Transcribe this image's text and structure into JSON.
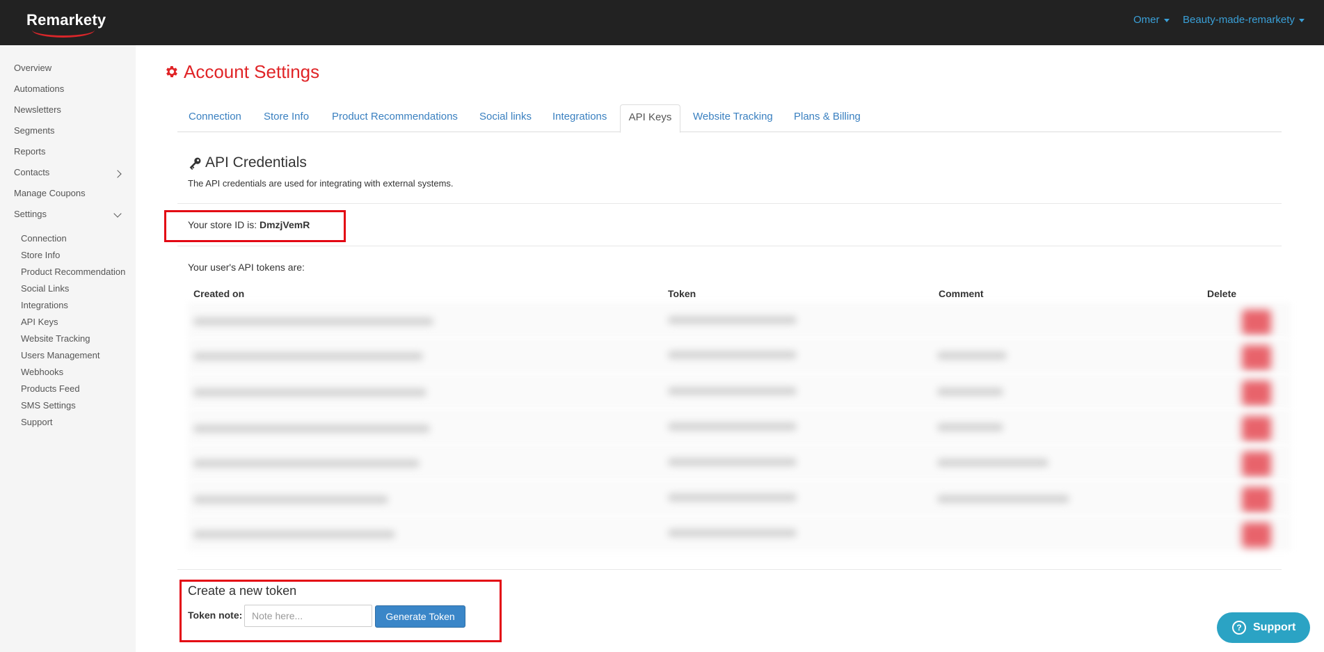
{
  "header": {
    "logo_text": "Remarkety",
    "user_menu": "Omer",
    "store_menu": "Beauty-made-remarkety"
  },
  "sidebar": {
    "items": [
      {
        "label": "Overview"
      },
      {
        "label": "Automations"
      },
      {
        "label": "Newsletters"
      },
      {
        "label": "Segments"
      },
      {
        "label": "Reports"
      },
      {
        "label": "Contacts"
      },
      {
        "label": "Manage Coupons"
      },
      {
        "label": "Settings"
      }
    ],
    "settings_subitems": [
      {
        "label": "Connection"
      },
      {
        "label": "Store Info"
      },
      {
        "label": "Product Recommendation"
      },
      {
        "label": "Social Links"
      },
      {
        "label": "Integrations"
      },
      {
        "label": "API Keys"
      },
      {
        "label": "Website Tracking"
      },
      {
        "label": "Users Management"
      },
      {
        "label": "Webhooks"
      },
      {
        "label": "Products Feed"
      },
      {
        "label": "SMS Settings"
      },
      {
        "label": "Support"
      }
    ]
  },
  "main": {
    "title": "Account Settings",
    "tabs": [
      {
        "label": "Connection"
      },
      {
        "label": "Store Info"
      },
      {
        "label": "Product Recommendations"
      },
      {
        "label": "Social links"
      },
      {
        "label": "Integrations"
      },
      {
        "label": "API Keys",
        "active": true
      },
      {
        "label": "Website Tracking"
      },
      {
        "label": "Plans & Billing"
      }
    ],
    "section_title": "API Credentials",
    "section_desc": "The API credentials are used for integrating with external systems.",
    "store_id_label": "Your store ID is:",
    "store_id_value": "DmzjVemR",
    "tokens_label": "Your user's API tokens are:",
    "table": {
      "headers": [
        "Created on",
        "Token",
        "Comment",
        "Delete"
      ]
    },
    "create": {
      "title": "Create a new token",
      "note_label": "Token note:",
      "note_placeholder": "Note here...",
      "button_label": "Generate Token"
    }
  },
  "support_widget": {
    "label": "Support"
  },
  "colors": {
    "accent_red": "#e02427",
    "link_blue": "#3a80c0",
    "primary_button": "#3a86c8",
    "highlight_box": "#e30613",
    "support_widget": "#2ba3c4"
  }
}
